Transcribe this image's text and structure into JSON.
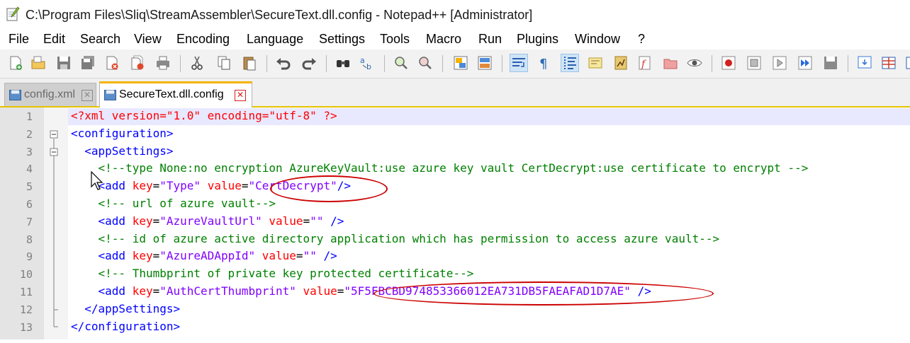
{
  "window": {
    "title": "C:\\Program Files\\Sliq\\StreamAssembler\\SecureText.dll.config - Notepad++ [Administrator]"
  },
  "menu": [
    "File",
    "Edit",
    "Search",
    "View",
    "Encoding",
    "Language",
    "Settings",
    "Tools",
    "Macro",
    "Run",
    "Plugins",
    "Window",
    "?"
  ],
  "toolbar": {
    "buttons": [
      "new-file-icon",
      "open-file-icon",
      "save-icon",
      "save-all-icon",
      "close-icon",
      "close-all-icon",
      "print-icon",
      "cut-icon",
      "copy-icon",
      "paste-icon",
      "undo-icon",
      "redo-icon",
      "find-icon",
      "replace-icon",
      "zoom-in-icon",
      "zoom-out-icon",
      "sync-vertical-icon",
      "sync-horizontal-icon",
      "word-wrap-icon",
      "show-all-characters-icon",
      "indent-guide-icon",
      "user-defined-language-icon",
      "document-map-icon",
      "function-list-icon",
      "folder-as-workspace-icon",
      "monitoring-icon",
      "record-macro-icon",
      "stop-recording-icon",
      "play-macro-icon",
      "run-macro-multiple-icon",
      "save-macro-icon",
      "tab-panel-icon",
      "table-icon",
      "columns-icon"
    ]
  },
  "tabs": [
    {
      "label": "config.xml",
      "active": false
    },
    {
      "label": "SecureText.dll.config",
      "active": true
    }
  ],
  "editor": {
    "line_numbers": [
      "1",
      "2",
      "3",
      "4",
      "5",
      "6",
      "7",
      "8",
      "9",
      "10",
      "11",
      "12",
      "13"
    ],
    "lines": [
      [
        {
          "t": "pi",
          "v": "<?xml version=\"1.0\" encoding=\"utf-8\" ?>"
        }
      ],
      [
        {
          "t": "tag",
          "v": "<configuration>"
        }
      ],
      [
        {
          "t": "txt",
          "v": "  "
        },
        {
          "t": "tag",
          "v": "<appSettings>"
        }
      ],
      [
        {
          "t": "txt",
          "v": "    "
        },
        {
          "t": "cmt",
          "v": "<!--type None:no encryption AzureKeyVault:use azure key vault CertDecrypt:use certificate to encrypt -->"
        }
      ],
      [
        {
          "t": "txt",
          "v": "    "
        },
        {
          "t": "tag",
          "v": "<add "
        },
        {
          "t": "attr",
          "v": "key"
        },
        {
          "t": "txt",
          "v": "="
        },
        {
          "t": "val",
          "v": "\"Type\""
        },
        {
          "t": "txt",
          "v": " "
        },
        {
          "t": "attr",
          "v": "value"
        },
        {
          "t": "txt",
          "v": "="
        },
        {
          "t": "val",
          "v": "\"CertDecrypt\""
        },
        {
          "t": "tag",
          "v": "/>"
        }
      ],
      [
        {
          "t": "txt",
          "v": "    "
        },
        {
          "t": "cmt",
          "v": "<!-- url of azure vault-->"
        }
      ],
      [
        {
          "t": "txt",
          "v": "    "
        },
        {
          "t": "tag",
          "v": "<add "
        },
        {
          "t": "attr",
          "v": "key"
        },
        {
          "t": "txt",
          "v": "="
        },
        {
          "t": "val",
          "v": "\"AzureVaultUrl\""
        },
        {
          "t": "txt",
          "v": " "
        },
        {
          "t": "attr",
          "v": "value"
        },
        {
          "t": "txt",
          "v": "="
        },
        {
          "t": "val",
          "v": "\"\""
        },
        {
          "t": "txt",
          "v": " "
        },
        {
          "t": "tag",
          "v": "/>"
        }
      ],
      [
        {
          "t": "txt",
          "v": "    "
        },
        {
          "t": "cmt",
          "v": "<!-- id of azure active directory application which has permission to access azure vault-->"
        }
      ],
      [
        {
          "t": "txt",
          "v": "    "
        },
        {
          "t": "tag",
          "v": "<add "
        },
        {
          "t": "attr",
          "v": "key"
        },
        {
          "t": "txt",
          "v": "="
        },
        {
          "t": "val",
          "v": "\"AzureADAppId\""
        },
        {
          "t": "txt",
          "v": " "
        },
        {
          "t": "attr",
          "v": "value"
        },
        {
          "t": "txt",
          "v": "="
        },
        {
          "t": "val",
          "v": "\"\""
        },
        {
          "t": "txt",
          "v": " "
        },
        {
          "t": "tag",
          "v": "/>"
        }
      ],
      [
        {
          "t": "txt",
          "v": "    "
        },
        {
          "t": "cmt",
          "v": "<!-- Thumbprint of private key protected certificate-->"
        }
      ],
      [
        {
          "t": "txt",
          "v": "    "
        },
        {
          "t": "tag",
          "v": "<add "
        },
        {
          "t": "attr",
          "v": "key"
        },
        {
          "t": "txt",
          "v": "="
        },
        {
          "t": "val",
          "v": "\"AuthCertThumbprint\""
        },
        {
          "t": "txt",
          "v": " "
        },
        {
          "t": "attr",
          "v": "value"
        },
        {
          "t": "txt",
          "v": "="
        },
        {
          "t": "val",
          "v": "\"5F5FBCBD974853366012EA731DB5FAEAFAD1D7AE\""
        },
        {
          "t": "txt",
          "v": " "
        },
        {
          "t": "tag",
          "v": "/>"
        }
      ],
      [
        {
          "t": "txt",
          "v": "  "
        },
        {
          "t": "tag",
          "v": "</appSettings>"
        }
      ],
      [
        {
          "t": "tag",
          "v": "</configuration>"
        }
      ]
    ]
  },
  "colors": {
    "annotation": "#cc0000",
    "tag": "#0000ff",
    "attribute": "#ff0000",
    "value": "#8000ff",
    "comment": "#008000",
    "current_line": "#e8e8ff"
  }
}
